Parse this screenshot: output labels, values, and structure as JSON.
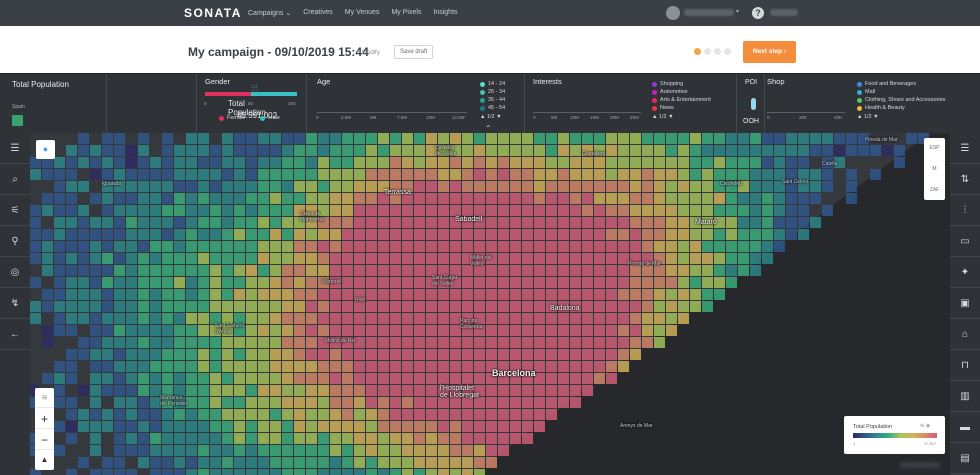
{
  "brand": {
    "logo": "SONATA"
  },
  "nav": {
    "items": [
      "Campaigns ⌄",
      "Creatives",
      "My Venues",
      "My Pixels",
      "Insights"
    ]
  },
  "user": {
    "help": "?"
  },
  "campaign": {
    "title": "My campaign - 09/10/2019 15:44",
    "modify": "Modify",
    "save_draft": "Save draft",
    "next_step": "Next step ›"
  },
  "filters": {
    "total_population": {
      "label": "Total Population",
      "country": "Spain"
    },
    "summary": {
      "title": "Total Population",
      "value": "45.591.002"
    },
    "gender": {
      "title": "Gender",
      "ticks": [
        "0",
        "50",
        "100"
      ],
      "legend": [
        {
          "label": "Female",
          "color": "#e0325f"
        },
        {
          "label": "Male",
          "color": "#38c1c5"
        }
      ]
    },
    "age": {
      "title": "Age",
      "ticks": [
        "0",
        "2.5M",
        "5M",
        "7.5M",
        "10M",
        "12.5M"
      ],
      "legend": [
        {
          "label": "14 - 24",
          "color": "#56e0cc"
        },
        {
          "label": "25 - 34",
          "color": "#3fc3b2"
        },
        {
          "label": "35 - 44",
          "color": "#2b9b94"
        },
        {
          "label": "45 - 54",
          "color": "#1f7a82"
        }
      ],
      "pager": "▲ 1/2 ▼"
    },
    "interests": {
      "title": "Interests",
      "ticks": [
        "0",
        "5M",
        "10M",
        "15M",
        "20M",
        "25M"
      ],
      "legend": [
        {
          "label": "Shopping",
          "color": "#8a3fd0"
        },
        {
          "label": "Automotive",
          "color": "#c427b8"
        },
        {
          "label": "Arts & Entertainment",
          "color": "#e8286a"
        },
        {
          "label": "News",
          "color": "#f0343a"
        }
      ],
      "pager": "▲ 1/2 ▼"
    },
    "poi": {
      "title": "POI",
      "ooh": "OOH"
    },
    "shop": {
      "title": "Shop",
      "ticks": [
        "0",
        "20K",
        "40K"
      ],
      "legend": [
        {
          "label": "Food and Beverages",
          "color": "#3c8fe0"
        },
        {
          "label": "Mall",
          "color": "#37b1d6"
        },
        {
          "label": "Clothing, Shoes and Accessories",
          "color": "#58c86a"
        },
        {
          "label": "Health & Beauty",
          "color": "#f0b93a"
        }
      ],
      "pager": "▲ 1/2 ▼"
    }
  },
  "map": {
    "cities": [
      {
        "name": "Terrassa",
        "cls": ""
      },
      {
        "name": "Sabadell",
        "cls": ""
      },
      {
        "name": "Mataró",
        "cls": ""
      },
      {
        "name": "Badalona",
        "cls": ""
      },
      {
        "name": "Barcelona",
        "cls": "big"
      },
      {
        "name": "l'Hospitalet\nde Llobregat",
        "cls": ""
      },
      {
        "name": "Igualada",
        "cls": "small"
      },
      {
        "name": "Olesa de\nMontserrat",
        "cls": "small"
      },
      {
        "name": "Martorell",
        "cls": "small"
      },
      {
        "name": "Sant Sadurní\nd'Anoia",
        "cls": "small"
      },
      {
        "name": "Castellar\ndel Vallès",
        "cls": "small"
      },
      {
        "name": "Granollers",
        "cls": "small"
      },
      {
        "name": "Cardedeu",
        "cls": "small"
      },
      {
        "name": "Sant Celoni",
        "cls": "small"
      },
      {
        "name": "Mollet del\nVallès",
        "cls": "small"
      },
      {
        "name": "Sant Cugat\ndel Vallès",
        "cls": "small"
      },
      {
        "name": "Rubí",
        "cls": "small"
      },
      {
        "name": "Molins de Rei",
        "cls": "small"
      },
      {
        "name": "Premià de Mar",
        "cls": "small"
      },
      {
        "name": "Calella",
        "cls": "small"
      },
      {
        "name": "Pineda de Mar",
        "cls": "small"
      },
      {
        "name": "Vilafranca\ndel Penedès",
        "cls": "small"
      },
      {
        "name": "Arenys de Mar",
        "cls": "small"
      },
      {
        "name": "Parc de\nCollserola",
        "cls": "small"
      }
    ],
    "country_switch": [
      "ESP",
      "M",
      "ZAF"
    ],
    "zoom": {
      "in": "+",
      "out": "−"
    },
    "legend": {
      "title": "Total Population",
      "min": "1",
      "max": "37.917"
    }
  },
  "colors": {
    "accent": "#f48e3c",
    "scale": [
      "#2e2b68",
      "#31588c",
      "#2d8a8c",
      "#3ab07c",
      "#a6c65a",
      "#d6b45a",
      "#d98a6a",
      "#d65f7a"
    ]
  }
}
